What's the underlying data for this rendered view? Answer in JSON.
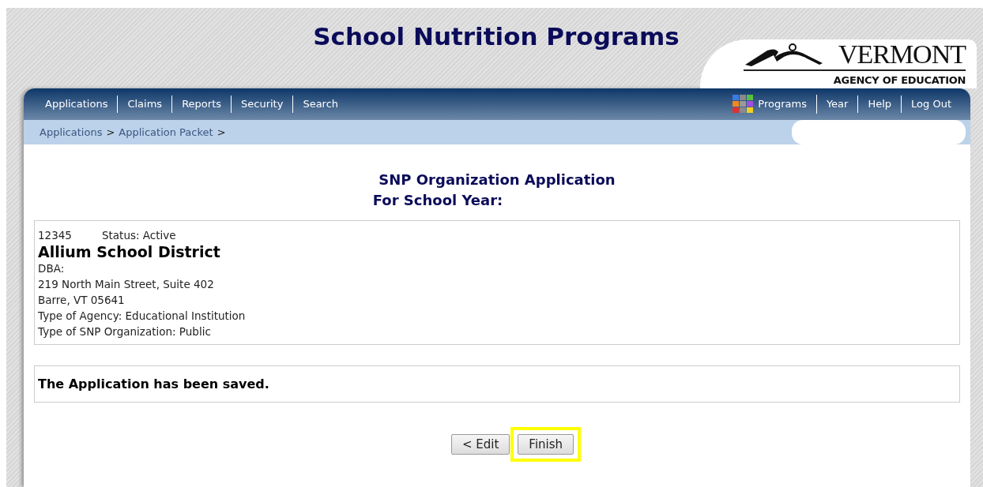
{
  "page_title": "School Nutrition Programs",
  "logo": {
    "name": "VERMONT",
    "subtitle": "AGENCY OF EDUCATION"
  },
  "nav_left": [
    {
      "label": "Applications"
    },
    {
      "label": "Claims"
    },
    {
      "label": "Reports"
    },
    {
      "label": "Security"
    },
    {
      "label": "Search"
    }
  ],
  "nav_right": [
    {
      "label": "Programs",
      "kind": "grid"
    },
    {
      "label": "Year",
      "kind": "plain"
    },
    {
      "label": "Help",
      "kind": "plain"
    },
    {
      "label": "Log Out",
      "kind": "plain"
    }
  ],
  "breadcrumb": [
    {
      "label": "Applications",
      "separator": ">"
    },
    {
      "label": "Application Packet",
      "separator": ">"
    }
  ],
  "redacted": true,
  "form": {
    "title": "SNP Organization Application",
    "year_label": "For School Year:"
  },
  "organization": {
    "id": "12345",
    "status": "Status: Active",
    "name": "Allium School District",
    "lines": [
      "DBA:",
      "219 North Main Street, Suite 402",
      "Barre, VT 05641",
      "Type of Agency: Educational Institution",
      "Type of SNP Organization: Public"
    ]
  },
  "message": "The Application has been saved.",
  "buttons": [
    {
      "label": "< Edit",
      "highlighted": false
    },
    {
      "label": "Finish",
      "highlighted": true
    }
  ]
}
